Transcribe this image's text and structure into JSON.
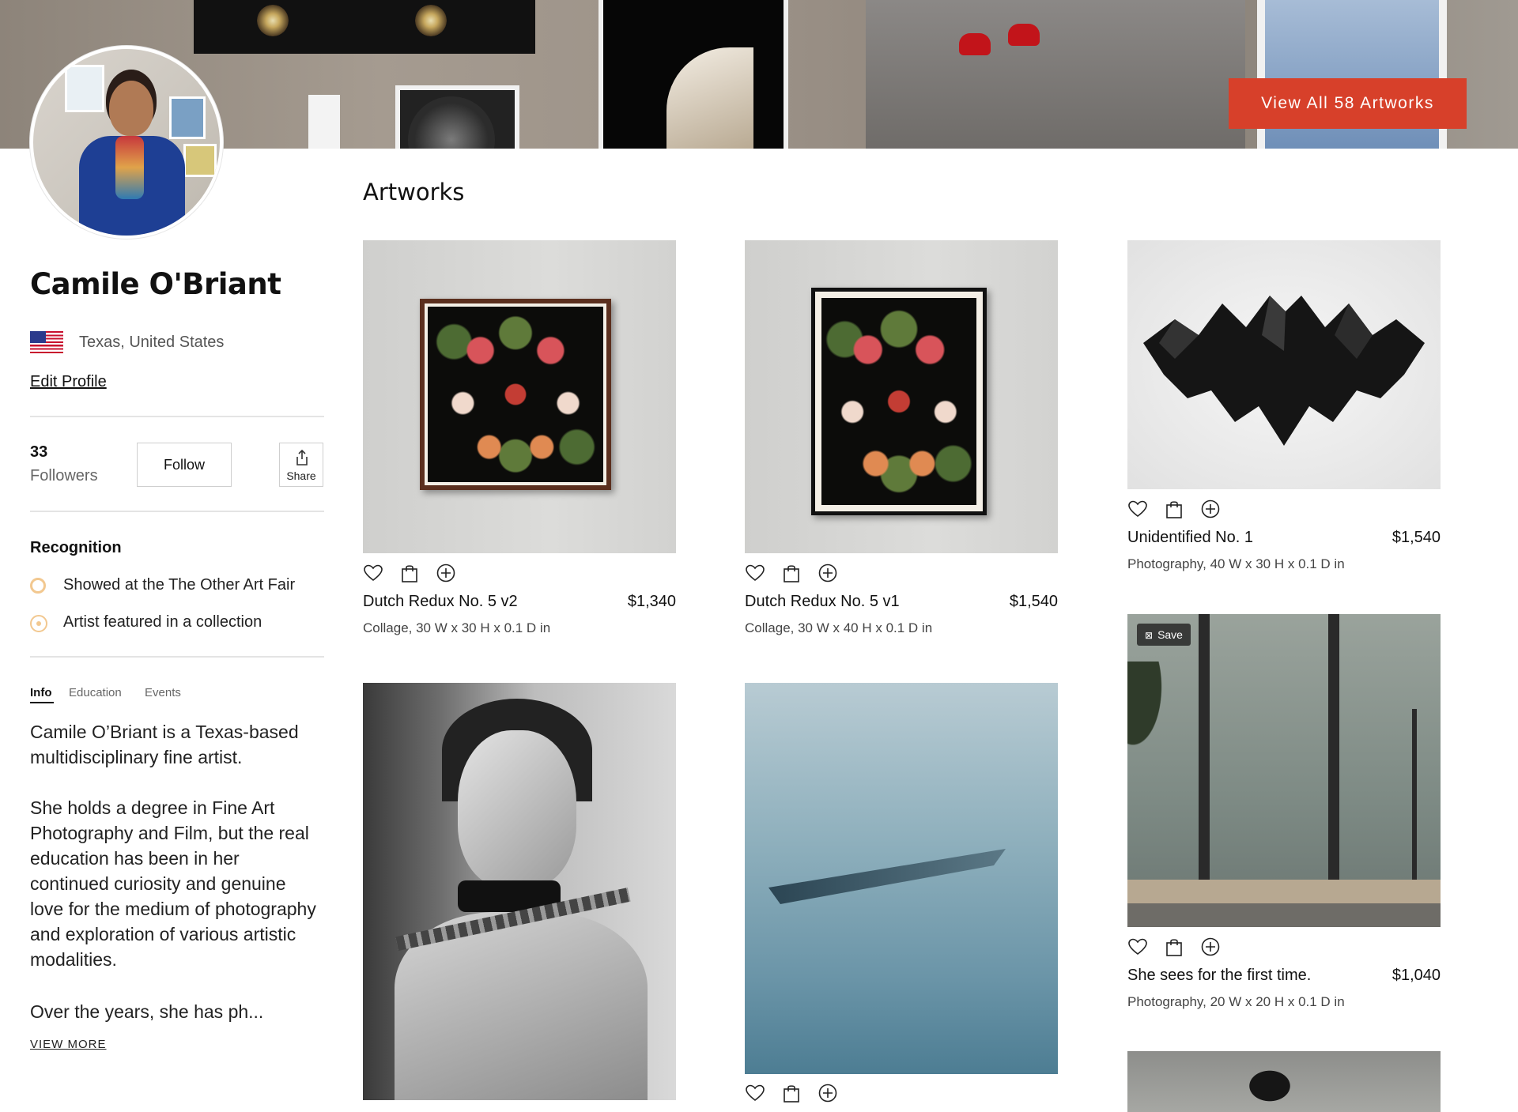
{
  "hero": {
    "view_all_label": "View All 58 Artworks"
  },
  "profile": {
    "name": "Camile O'Briant",
    "location": "Texas, United States",
    "edit_profile_label": "Edit Profile",
    "followers_count": "33",
    "followers_label": "Followers",
    "follow_label": "Follow",
    "share_label": "Share"
  },
  "recognition": {
    "title": "Recognition",
    "items": [
      {
        "label": "Showed at the The Other Art Fair",
        "icon": "ring-badge-icon"
      },
      {
        "label": "Artist featured in a collection",
        "icon": "collection-badge-icon"
      }
    ]
  },
  "tabs": [
    {
      "label": "Info",
      "active": true
    },
    {
      "label": "Education",
      "active": false
    },
    {
      "label": "Events",
      "active": false
    }
  ],
  "bio": {
    "paragraphs": [
      "Camile O’Briant is a Texas-based multidisciplinary fine artist.",
      "She holds a degree in Fine Art Photography and Film, but the real education has been in her continued curiosity and genuine love for the medium of photography and exploration of various artistic modalities.",
      "Over the years, she has ph..."
    ],
    "view_more_label": "VIEW MORE"
  },
  "artworks": {
    "title": "Artworks",
    "items": [
      {
        "title": "Dutch Redux No. 5 v2",
        "price": "$1,340",
        "meta": "Collage, 30 W x 30 H x 0.1 D in"
      },
      {
        "title": "Dutch Redux No. 5 v1",
        "price": "$1,540",
        "meta": "Collage, 30 W x 40 H x 0.1 D in"
      },
      {
        "title": "Unidentified No. 1",
        "price": "$1,540",
        "meta": "Photography, 40 W x 30 H x 0.1 D in"
      },
      {
        "title": "She sees for the first time.",
        "price": "$1,040",
        "meta": "Photography, 20 W x 20 H x 0.1 D in",
        "save_label": "Save"
      }
    ]
  },
  "colors": {
    "accent": "#d7402a",
    "badge": "#f2c890"
  }
}
